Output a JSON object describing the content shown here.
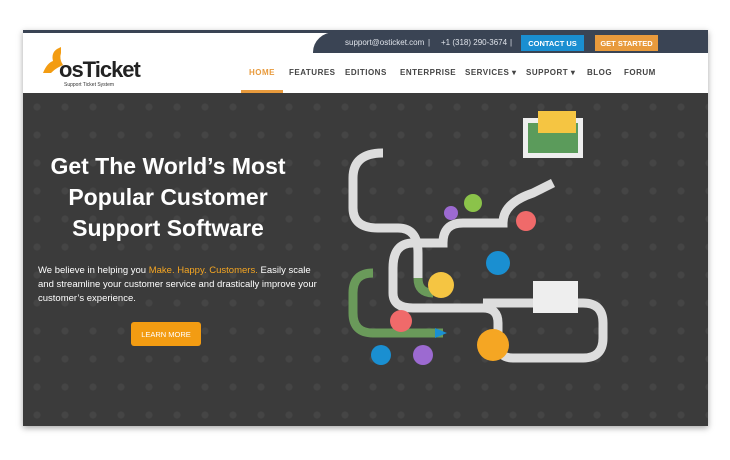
{
  "topbar": {
    "email": "support@osticket.com",
    "separator": "|",
    "phone": "+1 (318) 290-3674",
    "contact": "CONTACT US",
    "get_started": "GET STARTED"
  },
  "logo": {
    "name": "osTicket",
    "tagline": "Support Ticket System"
  },
  "nav": [
    "HOME",
    "FEATURES",
    "EDITIONS",
    "ENTERPRISE",
    "SERVICES ▾",
    "SUPPORT ▾",
    "BLOG",
    "FORUM"
  ],
  "hero": {
    "title_lines": [
      "Get The World’s Most",
      "Popular Customer",
      "Support Software"
    ],
    "para_before": "We believe in helping you ",
    "para_highlight": "Make. Happy. Customers.",
    "para_after": " Easily scale and streamline your customer service and drastically improve your customer’s experience.",
    "cta": "LEARN MORE"
  },
  "colors": {
    "navy": "#3a4454",
    "blue": "#1a8fd1",
    "orange": "#f39c12"
  }
}
